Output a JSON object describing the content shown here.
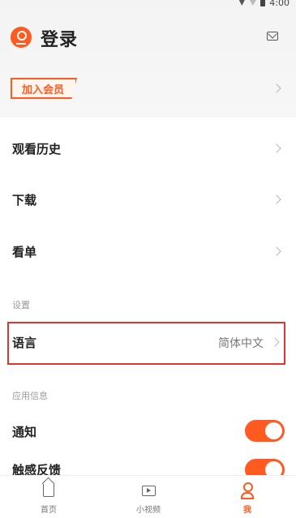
{
  "colors": {
    "accent": "#ff5a1f",
    "highlight": "#e4332b"
  },
  "status_bar": {
    "time": "4:00"
  },
  "header": {
    "title": "登录",
    "vip_label": "加入会员"
  },
  "menu": {
    "watch_history": "观看历史",
    "downloads": "下载",
    "watchlist": "看单"
  },
  "settings": {
    "section": "设置",
    "language_label": "语言",
    "language_value": "简体中文"
  },
  "app_info": {
    "section": "应用信息",
    "notifications": "通知",
    "notifications_on": true,
    "haptics": "触感反馈",
    "haptics_on": true
  },
  "tabbar": {
    "home": "首页",
    "short_video": "小视频",
    "me": "我",
    "active": "我"
  }
}
